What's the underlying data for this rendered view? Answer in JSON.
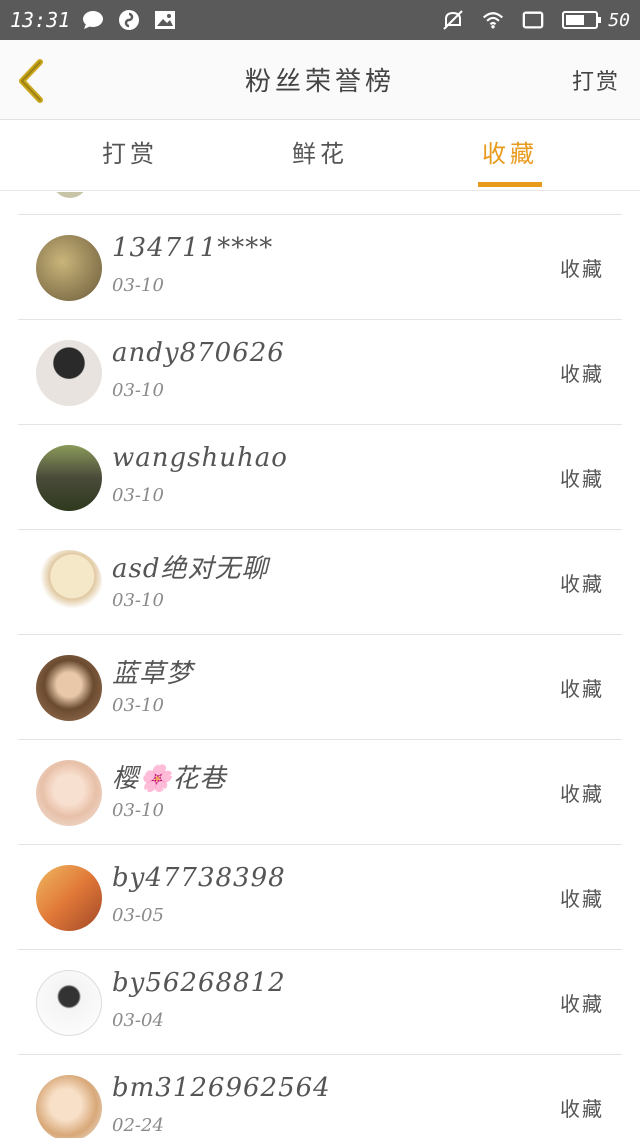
{
  "status_bar": {
    "time": "13:31",
    "battery": "50",
    "icons": [
      "chat-bubble-icon",
      "maps-icon",
      "image-icon",
      "mute-icon",
      "wifi-icon",
      "screen-icon",
      "battery-icon"
    ]
  },
  "header": {
    "title": "粉丝荣誉榜",
    "action_label": "打赏",
    "back_icon": "chevron-left-icon"
  },
  "tabs": [
    {
      "label": "打赏",
      "active": false
    },
    {
      "label": "鲜花",
      "active": false
    },
    {
      "label": "收藏",
      "active": true
    }
  ],
  "colors": {
    "accent": "#e89a1c",
    "status_bar": "#5a5a5a",
    "back_icon": "#c9a61a"
  },
  "fans": [
    {
      "name": "134711****",
      "date": "03-10",
      "action": "收藏",
      "avatar_colors": [
        "#6b5a3a",
        "#c9b57a"
      ]
    },
    {
      "name": "andy870626",
      "date": "03-10",
      "action": "收藏",
      "avatar_colors": [
        "#e8e3de",
        "#2a2a2a"
      ]
    },
    {
      "name": "wangshuhao",
      "date": "03-10",
      "action": "收藏",
      "avatar_colors": [
        "#6b7a3a",
        "#2e3a1e"
      ]
    },
    {
      "name": "asd绝对无聊",
      "date": "03-10",
      "action": "收藏",
      "avatar_colors": [
        "#f5e8c8",
        "#c89060"
      ]
    },
    {
      "name": "蓝草梦",
      "date": "03-10",
      "action": "收藏",
      "avatar_colors": [
        "#a07858",
        "#4a3020"
      ]
    },
    {
      "name": "樱🌸花巷",
      "date": "03-10",
      "action": "收藏",
      "avatar_colors": [
        "#f0d8c8",
        "#e8c0a8"
      ]
    },
    {
      "name": "by47738398",
      "date": "03-05",
      "action": "收藏",
      "avatar_colors": [
        "#e89848",
        "#a04828"
      ]
    },
    {
      "name": "by56268812",
      "date": "03-04",
      "action": "收藏",
      "avatar_colors": [
        "#f4f4f4",
        "#333333"
      ]
    },
    {
      "name": "bm3126962564",
      "date": "02-24",
      "action": "收藏",
      "avatar_colors": [
        "#f0d0b0",
        "#d8a878"
      ]
    }
  ]
}
